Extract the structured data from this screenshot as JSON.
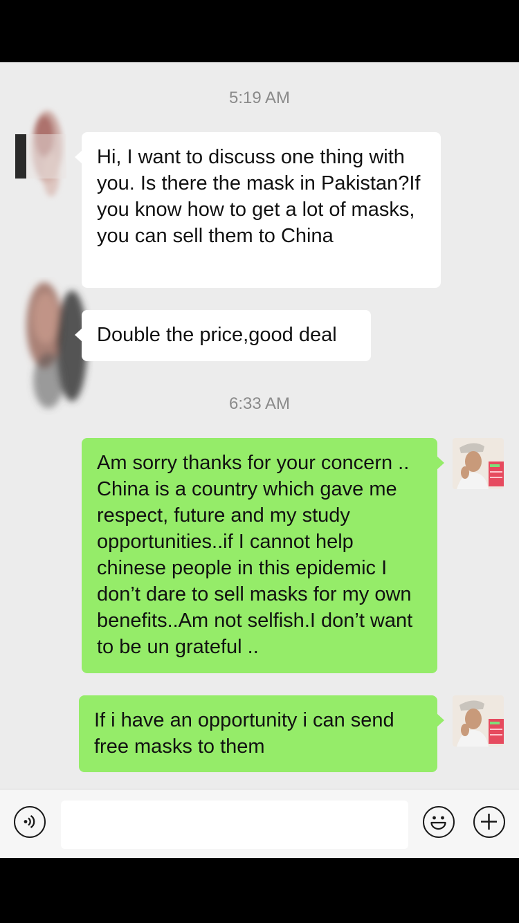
{
  "messages": {
    "timestamp_1": "5:19 AM",
    "msg_1": "Hi, I want to discuss one thing with you. Is there the mask in Pakistan?If you know how to get a lot of masks, you can sell them to China",
    "msg_2": "Double the price,good deal",
    "timestamp_2": "6:33 AM",
    "msg_3": "Am sorry thanks for your concern .. China is a country which gave me respect, future and my study opportunities..if I cannot help chinese people in this epidemic I don’t dare to sell masks for my own benefits..Am not selfish.I don’t want to be un grateful ..",
    "msg_4": "If i have an opportunity i can send free masks to them"
  },
  "colors": {
    "chat_background": "#ececec",
    "incoming_bubble": "#ffffff",
    "outgoing_bubble": "#95ec69",
    "timestamp_text": "#8a8a8a"
  },
  "input_bar": {
    "voice_icon": "voice-icon",
    "emoji_icon": "emoji-icon",
    "plus_icon": "plus-icon"
  }
}
